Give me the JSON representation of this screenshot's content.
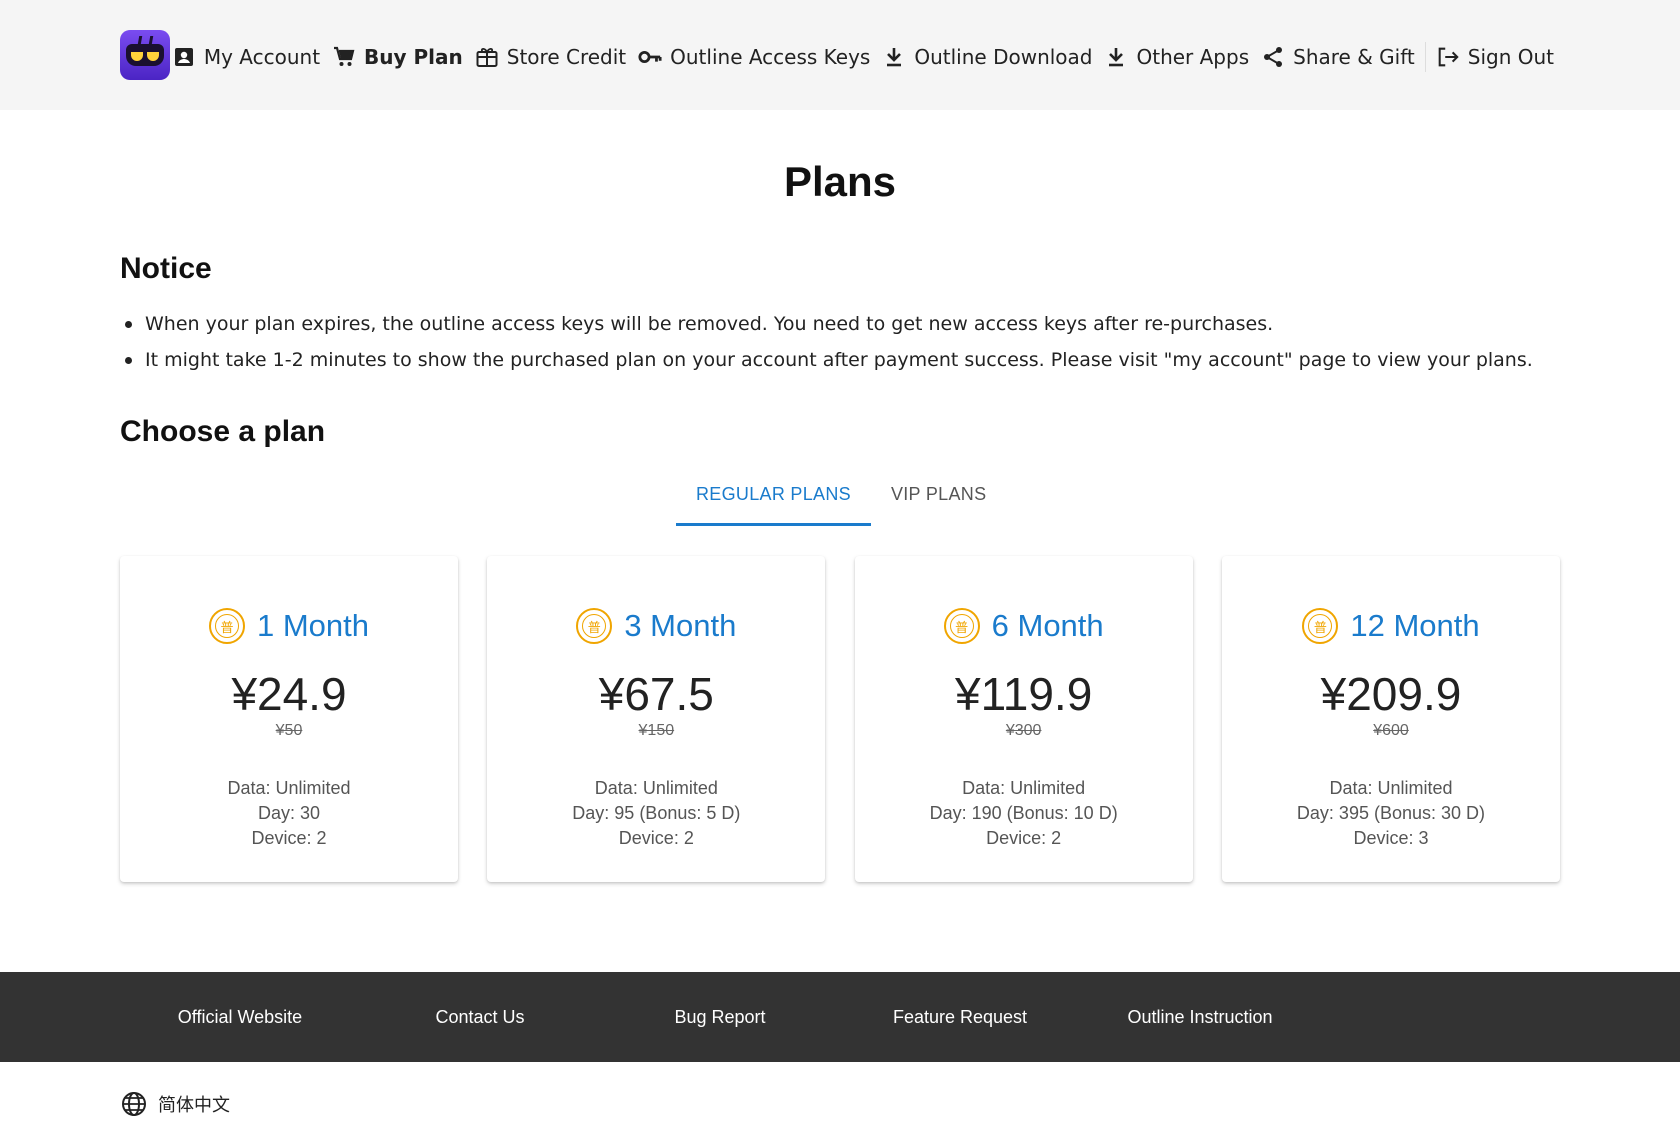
{
  "header": {
    "nav": [
      {
        "label": "My Account",
        "icon": "account-box-icon"
      },
      {
        "label": "Buy Plan",
        "icon": "cart-icon",
        "active": true
      },
      {
        "label": "Store Credit",
        "icon": "gift-card-icon"
      },
      {
        "label": "Outline Access Keys",
        "icon": "key-icon"
      },
      {
        "label": "Outline Download",
        "icon": "download-icon"
      },
      {
        "label": "Other Apps",
        "icon": "download-icon"
      },
      {
        "label": "Share & Gift",
        "icon": "share-icon"
      },
      {
        "label": "Sign Out",
        "icon": "logout-icon"
      }
    ]
  },
  "main": {
    "title": "Plans",
    "notice": {
      "heading": "Notice",
      "items": [
        "When your plan expires, the outline access keys will be removed. You need to get new access keys after re-purchases.",
        "It might take 1-2 minutes to show the purchased plan on your account after payment success. Please visit \"my account\" page to view your plans."
      ]
    },
    "choose_heading": "Choose a plan",
    "tabs": [
      {
        "label": "REGULAR PLANS",
        "active": true
      },
      {
        "label": "VIP PLANS",
        "active": false
      }
    ],
    "plans": [
      {
        "badge": "普",
        "name": "1 Month",
        "price": "¥24.9",
        "original": "¥50",
        "data": "Data: Unlimited",
        "day": "Day: 30",
        "device": "Device: 2"
      },
      {
        "badge": "普",
        "name": "3 Month",
        "price": "¥67.5",
        "original": "¥150",
        "data": "Data: Unlimited",
        "day": "Day: 95 (Bonus: 5 D)",
        "device": "Device: 2"
      },
      {
        "badge": "普",
        "name": "6 Month",
        "price": "¥119.9",
        "original": "¥300",
        "data": "Data: Unlimited",
        "day": "Day: 190 (Bonus: 10 D)",
        "device": "Device: 2"
      },
      {
        "badge": "普",
        "name": "12 Month",
        "price": "¥209.9",
        "original": "¥600",
        "data": "Data: Unlimited",
        "day": "Day: 395 (Bonus: 30 D)",
        "device": "Device: 3"
      }
    ]
  },
  "footer": {
    "links": [
      "Official Website",
      "Contact Us",
      "Bug Report",
      "Feature Request",
      "Outline Instruction"
    ]
  },
  "language": {
    "label": "简体中文",
    "icon": "globe-icon"
  },
  "colors": {
    "accent": "#1a7bcc",
    "badge": "#f0a500",
    "footer_bg": "#333333",
    "header_bg": "#f5f5f5"
  }
}
